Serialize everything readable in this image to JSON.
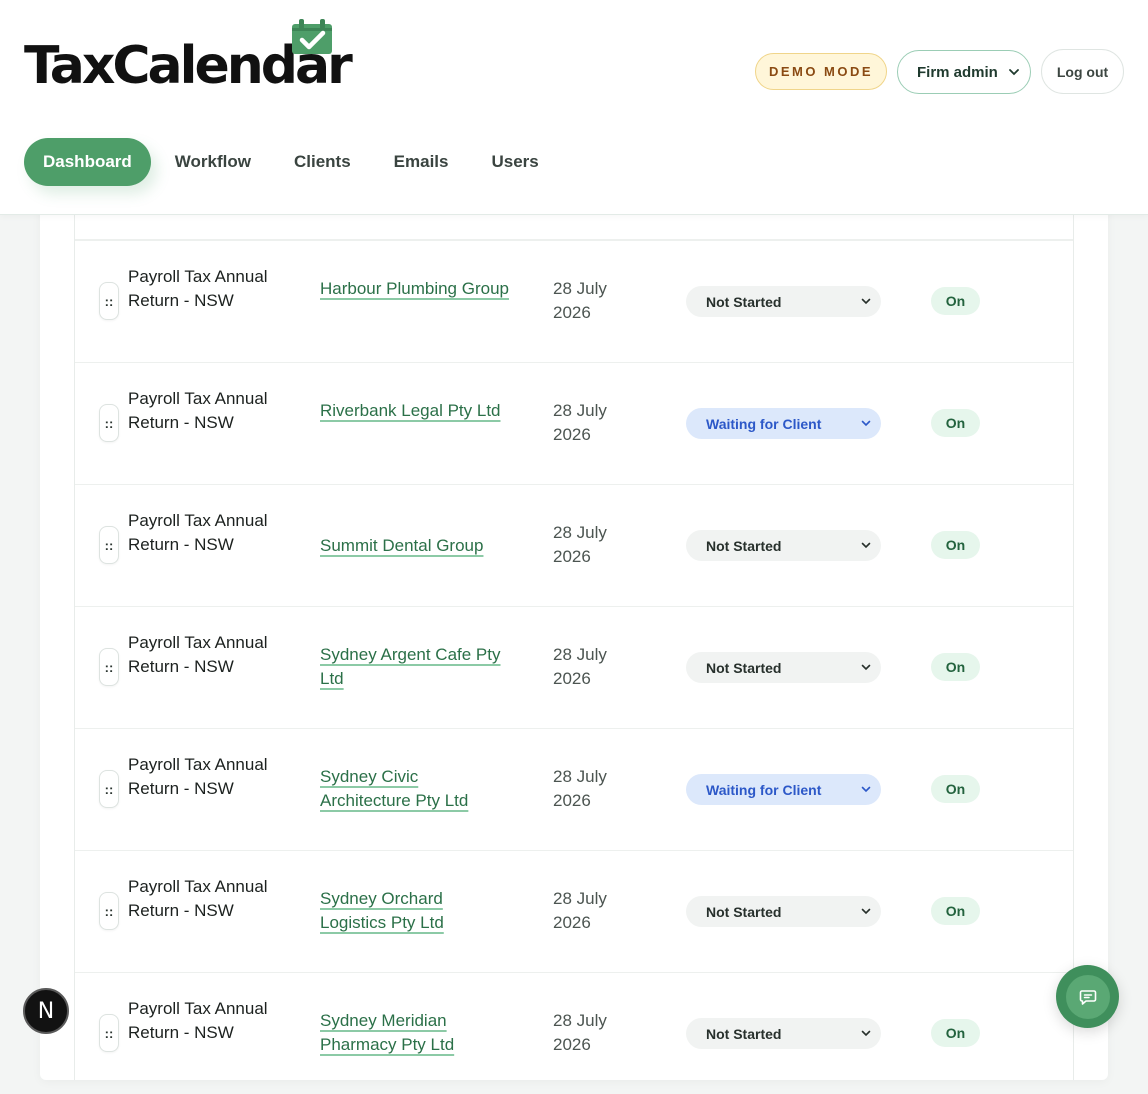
{
  "app": {
    "logo_text": "TaxCalendar",
    "demo_badge": "DEMO MODE",
    "role_selected": "Firm admin",
    "logout_label": "Log out"
  },
  "nav": {
    "items": [
      {
        "label": "Dashboard",
        "active": true
      },
      {
        "label": "Workflow",
        "active": false
      },
      {
        "label": "Clients",
        "active": false
      },
      {
        "label": "Emails",
        "active": false
      },
      {
        "label": "Users",
        "active": false
      }
    ]
  },
  "rows": [
    {
      "task": "Payroll Tax Annual Return - NSW",
      "client": "Harbour Plumbing Group",
      "due": "28 July 2026",
      "status": "Not Started",
      "reminder": "On"
    },
    {
      "task": "Payroll Tax Annual Return - NSW",
      "client": "Riverbank Legal Pty Ltd",
      "due": "28 July 2026",
      "status": "Waiting for Client",
      "reminder": "On"
    },
    {
      "task": "Payroll Tax Annual Return - NSW",
      "client": "Summit Dental Group",
      "due": "28 July 2026",
      "status": "Not Started",
      "reminder": "On"
    },
    {
      "task": "Payroll Tax Annual Return - NSW",
      "client": "Sydney Argent Cafe Pty Ltd",
      "due": "28 July 2026",
      "status": "Not Started",
      "reminder": "On"
    },
    {
      "task": "Payroll Tax Annual Return - NSW",
      "client": "Sydney Civic Architecture Pty Ltd",
      "due": "28 July 2026",
      "status": "Waiting for Client",
      "reminder": "On"
    },
    {
      "task": "Payroll Tax Annual Return - NSW",
      "client": "Sydney Orchard Logistics Pty Ltd",
      "due": "28 July 2026",
      "status": "Not Started",
      "reminder": "On"
    },
    {
      "task": "Payroll Tax Annual Return - NSW",
      "client": "Sydney Meridian Pharmacy Pty Ltd",
      "due": "28 July 2026",
      "status": "Not Started",
      "reminder": "On"
    }
  ],
  "drag_handle_glyph": "::",
  "floating": {
    "dev_badge": "N"
  },
  "colors": {
    "brand_green": "#4e9e69",
    "link_green": "#2b7048",
    "waiting_blue": "#2c58c8",
    "demo_amber": "#8a4a12"
  }
}
